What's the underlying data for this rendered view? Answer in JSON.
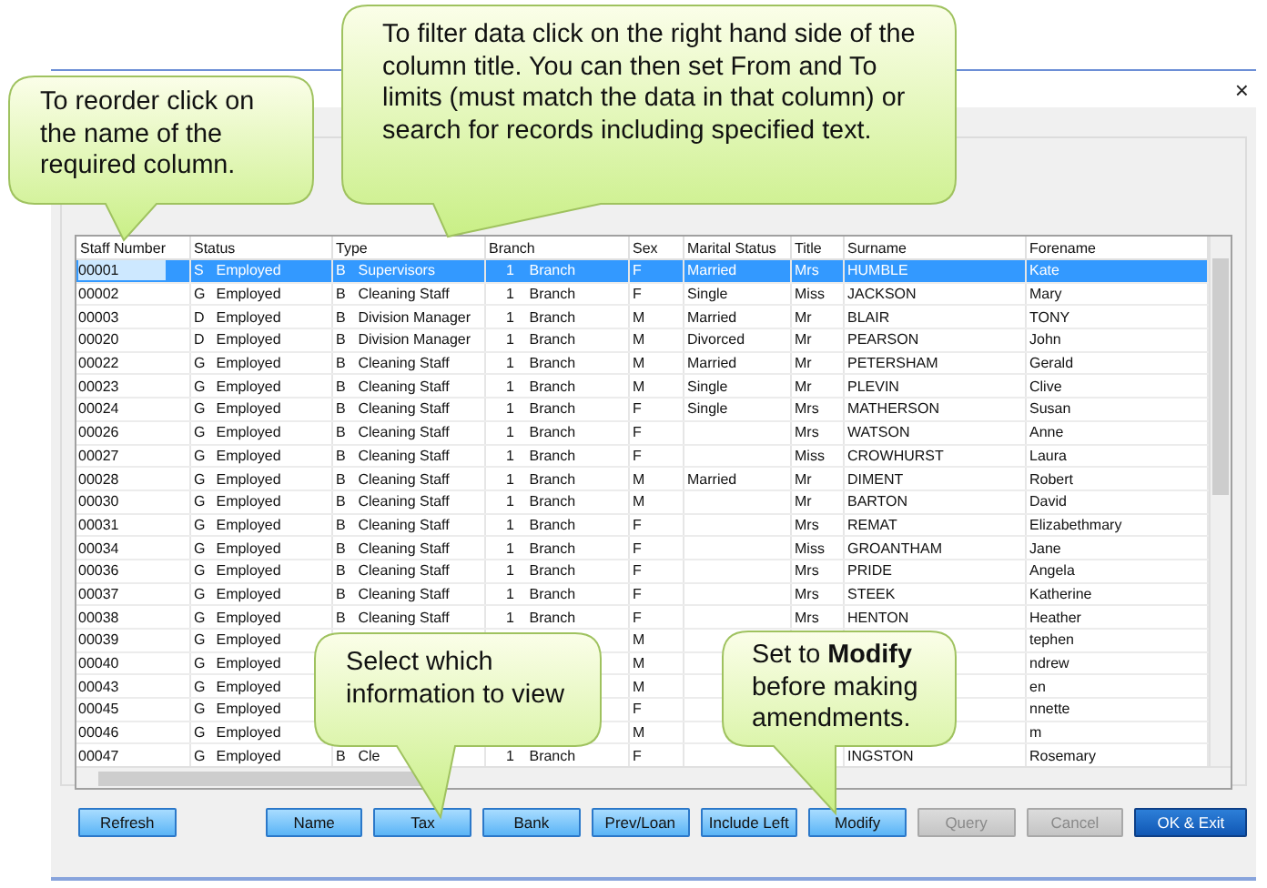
{
  "window": {
    "close": "×"
  },
  "table": {
    "columns": [
      {
        "label": "Staff Number"
      },
      {
        "label": "Status"
      },
      {
        "label": "Type"
      },
      {
        "label": "Branch"
      },
      {
        "label": "Sex"
      },
      {
        "label": "Marital Status"
      },
      {
        "label": "Title"
      },
      {
        "label": "Surname"
      },
      {
        "label": "Forename"
      }
    ],
    "rows": [
      {
        "selected": true,
        "staff_number": "00001",
        "status_code": "S",
        "status": "Employed",
        "type_code": "B",
        "type": "Supervisors",
        "branch_no": "1",
        "branch": "Branch",
        "sex": "F",
        "marital_status": "Married",
        "title": "Mrs",
        "surname": "HUMBLE",
        "forename": "Kate"
      },
      {
        "selected": false,
        "staff_number": "00002",
        "status_code": "G",
        "status": "Employed",
        "type_code": "B",
        "type": "Cleaning Staff",
        "branch_no": "1",
        "branch": "Branch",
        "sex": "F",
        "marital_status": "Single",
        "title": "Miss",
        "surname": "JACKSON",
        "forename": "Mary"
      },
      {
        "selected": false,
        "staff_number": "00003",
        "status_code": "D",
        "status": "Employed",
        "type_code": "B",
        "type": "Division Manager",
        "branch_no": "1",
        "branch": "Branch",
        "sex": "M",
        "marital_status": "Married",
        "title": "Mr",
        "surname": "BLAIR",
        "forename": "TONY"
      },
      {
        "selected": false,
        "staff_number": "00020",
        "status_code": "D",
        "status": "Employed",
        "type_code": "B",
        "type": "Division Manager",
        "branch_no": "1",
        "branch": "Branch",
        "sex": "M",
        "marital_status": "Divorced",
        "title": "Mr",
        "surname": "PEARSON",
        "forename": "John"
      },
      {
        "selected": false,
        "staff_number": "00022",
        "status_code": "G",
        "status": "Employed",
        "type_code": "B",
        "type": "Cleaning Staff",
        "branch_no": "1",
        "branch": "Branch",
        "sex": "M",
        "marital_status": "Married",
        "title": "Mr",
        "surname": "PETERSHAM",
        "forename": "Gerald"
      },
      {
        "selected": false,
        "staff_number": "00023",
        "status_code": "G",
        "status": "Employed",
        "type_code": "B",
        "type": "Cleaning Staff",
        "branch_no": "1",
        "branch": "Branch",
        "sex": "M",
        "marital_status": "Single",
        "title": "Mr",
        "surname": "PLEVIN",
        "forename": "Clive"
      },
      {
        "selected": false,
        "staff_number": "00024",
        "status_code": "G",
        "status": "Employed",
        "type_code": "B",
        "type": "Cleaning Staff",
        "branch_no": "1",
        "branch": "Branch",
        "sex": "F",
        "marital_status": "Single",
        "title": "Mrs",
        "surname": "MATHERSON",
        "forename": "Susan"
      },
      {
        "selected": false,
        "staff_number": "00026",
        "status_code": "G",
        "status": "Employed",
        "type_code": "B",
        "type": "Cleaning Staff",
        "branch_no": "1",
        "branch": "Branch",
        "sex": "F",
        "title": "Mrs",
        "surname": "WATSON",
        "forename": "Anne"
      },
      {
        "selected": false,
        "staff_number": "00027",
        "status_code": "G",
        "status": "Employed",
        "type_code": "B",
        "type": "Cleaning Staff",
        "branch_no": "1",
        "branch": "Branch",
        "sex": "F",
        "title": "Miss",
        "surname": "CROWHURST",
        "forename": "Laura"
      },
      {
        "selected": false,
        "staff_number": "00028",
        "status_code": "G",
        "status": "Employed",
        "type_code": "B",
        "type": "Cleaning Staff",
        "branch_no": "1",
        "branch": "Branch",
        "sex": "M",
        "marital_status": "Married",
        "title": "Mr",
        "surname": "DIMENT",
        "forename": "Robert"
      },
      {
        "selected": false,
        "staff_number": "00030",
        "status_code": "G",
        "status": "Employed",
        "type_code": "B",
        "type": "Cleaning Staff",
        "branch_no": "1",
        "branch": "Branch",
        "sex": "M",
        "title": "Mr",
        "surname": "BARTON",
        "forename": "David"
      },
      {
        "selected": false,
        "staff_number": "00031",
        "status_code": "G",
        "status": "Employed",
        "type_code": "B",
        "type": "Cleaning Staff",
        "branch_no": "1",
        "branch": "Branch",
        "sex": "F",
        "title": "Mrs",
        "surname": "REMAT",
        "forename": "Elizabethmary"
      },
      {
        "selected": false,
        "staff_number": "00034",
        "status_code": "G",
        "status": "Employed",
        "type_code": "B",
        "type": "Cleaning Staff",
        "branch_no": "1",
        "branch": "Branch",
        "sex": "F",
        "title": "Miss",
        "surname": "GROANTHAM",
        "forename": "Jane"
      },
      {
        "selected": false,
        "staff_number": "00036",
        "status_code": "G",
        "status": "Employed",
        "type_code": "B",
        "type": "Cleaning Staff",
        "branch_no": "1",
        "branch": "Branch",
        "sex": "F",
        "title": "Mrs",
        "surname": "PRIDE",
        "forename": "Angela"
      },
      {
        "selected": false,
        "staff_number": "00037",
        "status_code": "G",
        "status": "Employed",
        "type_code": "B",
        "type": "Cleaning Staff",
        "branch_no": "1",
        "branch": "Branch",
        "sex": "F",
        "title": "Mrs",
        "surname": "STEEK",
        "forename": "Katherine"
      },
      {
        "selected": false,
        "staff_number": "00038",
        "status_code": "G",
        "status": "Employed",
        "type_code": "B",
        "type": "Cleaning Staff",
        "branch_no": "1",
        "branch": "Branch",
        "sex": "F",
        "title": "Mrs",
        "surname": "HENTON",
        "forename": "Heather"
      },
      {
        "selected": false,
        "staff_number": "00039",
        "status_code": "G",
        "status": "Employed",
        "sex": "M",
        "forename": "tephen"
      },
      {
        "selected": false,
        "staff_number": "00040",
        "status_code": "G",
        "status": "Employed",
        "sex": "M",
        "forename": "ndrew"
      },
      {
        "selected": false,
        "staff_number": "00043",
        "status_code": "G",
        "status": "Employed",
        "sex": "M",
        "forename": "en"
      },
      {
        "selected": false,
        "staff_number": "00045",
        "status_code": "G",
        "status": "Employed",
        "sex": "F",
        "forename": "nnette"
      },
      {
        "selected": false,
        "staff_number": "00046",
        "status_code": "G",
        "status": "Employed",
        "sex": "M",
        "forename": "m"
      },
      {
        "selected": false,
        "staff_number": "00047",
        "status_code": "G",
        "status": "Employed",
        "type_code": "B",
        "type": "Cle",
        "branch_no": "1",
        "branch": "Branch",
        "sex": "F",
        "surname": "INGSTON",
        "forename": "Rosemary"
      }
    ]
  },
  "buttons": [
    {
      "label": "Refresh",
      "kind": "default",
      "disabled": false
    },
    {
      "label": "Name",
      "kind": "default",
      "disabled": false
    },
    {
      "label": "Tax",
      "kind": "default",
      "disabled": false
    },
    {
      "label": "Bank",
      "kind": "default",
      "disabled": false
    },
    {
      "label": "Prev/Loan",
      "kind": "default",
      "disabled": false
    },
    {
      "label": "Include Left",
      "kind": "default",
      "disabled": false
    },
    {
      "label": "Modify",
      "kind": "default",
      "disabled": false
    },
    {
      "label": "Query",
      "kind": "default",
      "disabled": true
    },
    {
      "label": "Cancel",
      "kind": "default",
      "disabled": true
    },
    {
      "label": "OK & Exit",
      "kind": "primary",
      "disabled": false
    }
  ],
  "callouts": [
    {
      "text": "To reorder click on the name of the required column."
    },
    {
      "text": "To filter data click on the right hand side of the column title. You can then set From and To limits (must match the data in that column) or search for records including specified text."
    },
    {
      "text": "Select which information to view"
    },
    {
      "text": "Set to **Modify** before making amendments."
    }
  ]
}
